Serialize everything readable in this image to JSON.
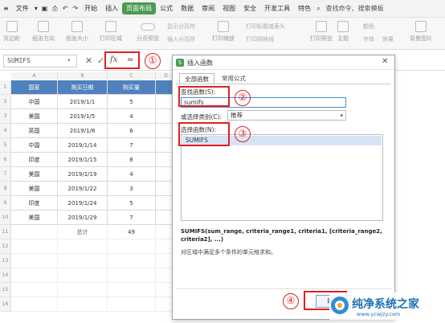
{
  "menubar": {
    "file_label": "文件",
    "items": [
      "开始",
      "插入",
      "页面布局",
      "公式",
      "数据",
      "审阅",
      "视图",
      "安全",
      "开发工具",
      "特色"
    ],
    "active_index": 2,
    "search_placeholder": "查找命令、搜索模板"
  },
  "toolbar": {
    "page_margin": "页边距",
    "orientation": "纸张方向",
    "paper_size": "纸张大小",
    "print_area": "打印区域",
    "page_break_preview": "分页预览",
    "show_page_break": "显示分页符",
    "insert_page_break": "插入分页符",
    "print_scale": "打印缩放",
    "print_title_header": "打印标题或表头",
    "print_gridlines": "打印网格线",
    "print_preview": "打印预览",
    "theme": "主题",
    "color": "颜色",
    "font": "字体",
    "effect": "效果",
    "background": "背景图片"
  },
  "formula_bar": {
    "name_box": "SUMIFS",
    "fx": "fx",
    "content": "="
  },
  "sheet": {
    "col_headers": [
      "A",
      "B",
      "C",
      "D"
    ],
    "header_row": [
      "国家",
      "购买日期",
      "购买量"
    ],
    "rows": [
      [
        "中国",
        "2019/1/1",
        "5"
      ],
      [
        "美国",
        "2019/1/5",
        "4"
      ],
      [
        "英国",
        "2019/1/8",
        "6"
      ],
      [
        "中国",
        "2019/1/14",
        "7"
      ],
      [
        "印度",
        "2019/1/15",
        "8"
      ],
      [
        "美国",
        "2019/1/19",
        "4"
      ],
      [
        "美国",
        "2019/1/22",
        "3"
      ],
      [
        "印度",
        "2019/1/24",
        "5"
      ],
      [
        "美国",
        "2019/1/29",
        "7"
      ]
    ],
    "total_label": "总计",
    "total_value": "49",
    "row_numbers": [
      "1",
      "2",
      "3",
      "4",
      "5",
      "6",
      "7",
      "8",
      "9",
      "10",
      "11",
      "12",
      "13",
      "14",
      "15",
      "16"
    ]
  },
  "dialog": {
    "title": "插入函数",
    "tabs": [
      "全部函数",
      "常用公式"
    ],
    "search_label": "查找函数(S):",
    "search_value": "sumifs",
    "category_label": "或选择类别(C):",
    "category_value": "推荐",
    "select_label": "选择函数(N):",
    "functions": [
      "SUMIFS"
    ],
    "signature": "SUMIFS(sum_range, criteria_range1, criteria1, [criteria_range2, criteria2], ...)",
    "description": "对区域中满足多个条件的单元格求和。",
    "ok_label": "确定"
  },
  "annotations": [
    "①",
    "②",
    "③",
    "④"
  ],
  "watermark": {
    "text": "纯净系统之家",
    "url": "www.ycwjzy.com"
  },
  "colors": {
    "accent_green": "#4a9b51",
    "header_blue": "#4f81bd",
    "annotation_red": "#e02020",
    "selected_blue": "#d6e4f5"
  }
}
